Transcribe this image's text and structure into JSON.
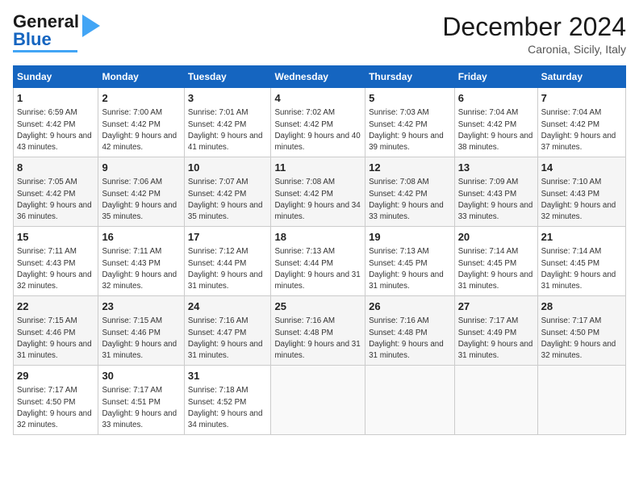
{
  "header": {
    "logo_main": "General",
    "logo_sub": "Blue",
    "title": "December 2024",
    "subtitle": "Caronia, Sicily, Italy"
  },
  "columns": [
    "Sunday",
    "Monday",
    "Tuesday",
    "Wednesday",
    "Thursday",
    "Friday",
    "Saturday"
  ],
  "weeks": [
    [
      {
        "day": "1",
        "sunrise": "Sunrise: 6:59 AM",
        "sunset": "Sunset: 4:42 PM",
        "daylight": "Daylight: 9 hours and 43 minutes."
      },
      {
        "day": "2",
        "sunrise": "Sunrise: 7:00 AM",
        "sunset": "Sunset: 4:42 PM",
        "daylight": "Daylight: 9 hours and 42 minutes."
      },
      {
        "day": "3",
        "sunrise": "Sunrise: 7:01 AM",
        "sunset": "Sunset: 4:42 PM",
        "daylight": "Daylight: 9 hours and 41 minutes."
      },
      {
        "day": "4",
        "sunrise": "Sunrise: 7:02 AM",
        "sunset": "Sunset: 4:42 PM",
        "daylight": "Daylight: 9 hours and 40 minutes."
      },
      {
        "day": "5",
        "sunrise": "Sunrise: 7:03 AM",
        "sunset": "Sunset: 4:42 PM",
        "daylight": "Daylight: 9 hours and 39 minutes."
      },
      {
        "day": "6",
        "sunrise": "Sunrise: 7:04 AM",
        "sunset": "Sunset: 4:42 PM",
        "daylight": "Daylight: 9 hours and 38 minutes."
      },
      {
        "day": "7",
        "sunrise": "Sunrise: 7:04 AM",
        "sunset": "Sunset: 4:42 PM",
        "daylight": "Daylight: 9 hours and 37 minutes."
      }
    ],
    [
      {
        "day": "8",
        "sunrise": "Sunrise: 7:05 AM",
        "sunset": "Sunset: 4:42 PM",
        "daylight": "Daylight: 9 hours and 36 minutes."
      },
      {
        "day": "9",
        "sunrise": "Sunrise: 7:06 AM",
        "sunset": "Sunset: 4:42 PM",
        "daylight": "Daylight: 9 hours and 35 minutes."
      },
      {
        "day": "10",
        "sunrise": "Sunrise: 7:07 AM",
        "sunset": "Sunset: 4:42 PM",
        "daylight": "Daylight: 9 hours and 35 minutes."
      },
      {
        "day": "11",
        "sunrise": "Sunrise: 7:08 AM",
        "sunset": "Sunset: 4:42 PM",
        "daylight": "Daylight: 9 hours and 34 minutes."
      },
      {
        "day": "12",
        "sunrise": "Sunrise: 7:08 AM",
        "sunset": "Sunset: 4:42 PM",
        "daylight": "Daylight: 9 hours and 33 minutes."
      },
      {
        "day": "13",
        "sunrise": "Sunrise: 7:09 AM",
        "sunset": "Sunset: 4:43 PM",
        "daylight": "Daylight: 9 hours and 33 minutes."
      },
      {
        "day": "14",
        "sunrise": "Sunrise: 7:10 AM",
        "sunset": "Sunset: 4:43 PM",
        "daylight": "Daylight: 9 hours and 32 minutes."
      }
    ],
    [
      {
        "day": "15",
        "sunrise": "Sunrise: 7:11 AM",
        "sunset": "Sunset: 4:43 PM",
        "daylight": "Daylight: 9 hours and 32 minutes."
      },
      {
        "day": "16",
        "sunrise": "Sunrise: 7:11 AM",
        "sunset": "Sunset: 4:43 PM",
        "daylight": "Daylight: 9 hours and 32 minutes."
      },
      {
        "day": "17",
        "sunrise": "Sunrise: 7:12 AM",
        "sunset": "Sunset: 4:44 PM",
        "daylight": "Daylight: 9 hours and 31 minutes."
      },
      {
        "day": "18",
        "sunrise": "Sunrise: 7:13 AM",
        "sunset": "Sunset: 4:44 PM",
        "daylight": "Daylight: 9 hours and 31 minutes."
      },
      {
        "day": "19",
        "sunrise": "Sunrise: 7:13 AM",
        "sunset": "Sunset: 4:45 PM",
        "daylight": "Daylight: 9 hours and 31 minutes."
      },
      {
        "day": "20",
        "sunrise": "Sunrise: 7:14 AM",
        "sunset": "Sunset: 4:45 PM",
        "daylight": "Daylight: 9 hours and 31 minutes."
      },
      {
        "day": "21",
        "sunrise": "Sunrise: 7:14 AM",
        "sunset": "Sunset: 4:45 PM",
        "daylight": "Daylight: 9 hours and 31 minutes."
      }
    ],
    [
      {
        "day": "22",
        "sunrise": "Sunrise: 7:15 AM",
        "sunset": "Sunset: 4:46 PM",
        "daylight": "Daylight: 9 hours and 31 minutes."
      },
      {
        "day": "23",
        "sunrise": "Sunrise: 7:15 AM",
        "sunset": "Sunset: 4:46 PM",
        "daylight": "Daylight: 9 hours and 31 minutes."
      },
      {
        "day": "24",
        "sunrise": "Sunrise: 7:16 AM",
        "sunset": "Sunset: 4:47 PM",
        "daylight": "Daylight: 9 hours and 31 minutes."
      },
      {
        "day": "25",
        "sunrise": "Sunrise: 7:16 AM",
        "sunset": "Sunset: 4:48 PM",
        "daylight": "Daylight: 9 hours and 31 minutes."
      },
      {
        "day": "26",
        "sunrise": "Sunrise: 7:16 AM",
        "sunset": "Sunset: 4:48 PM",
        "daylight": "Daylight: 9 hours and 31 minutes."
      },
      {
        "day": "27",
        "sunrise": "Sunrise: 7:17 AM",
        "sunset": "Sunset: 4:49 PM",
        "daylight": "Daylight: 9 hours and 31 minutes."
      },
      {
        "day": "28",
        "sunrise": "Sunrise: 7:17 AM",
        "sunset": "Sunset: 4:50 PM",
        "daylight": "Daylight: 9 hours and 32 minutes."
      }
    ],
    [
      {
        "day": "29",
        "sunrise": "Sunrise: 7:17 AM",
        "sunset": "Sunset: 4:50 PM",
        "daylight": "Daylight: 9 hours and 32 minutes."
      },
      {
        "day": "30",
        "sunrise": "Sunrise: 7:17 AM",
        "sunset": "Sunset: 4:51 PM",
        "daylight": "Daylight: 9 hours and 33 minutes."
      },
      {
        "day": "31",
        "sunrise": "Sunrise: 7:18 AM",
        "sunset": "Sunset: 4:52 PM",
        "daylight": "Daylight: 9 hours and 34 minutes."
      },
      null,
      null,
      null,
      null
    ]
  ]
}
